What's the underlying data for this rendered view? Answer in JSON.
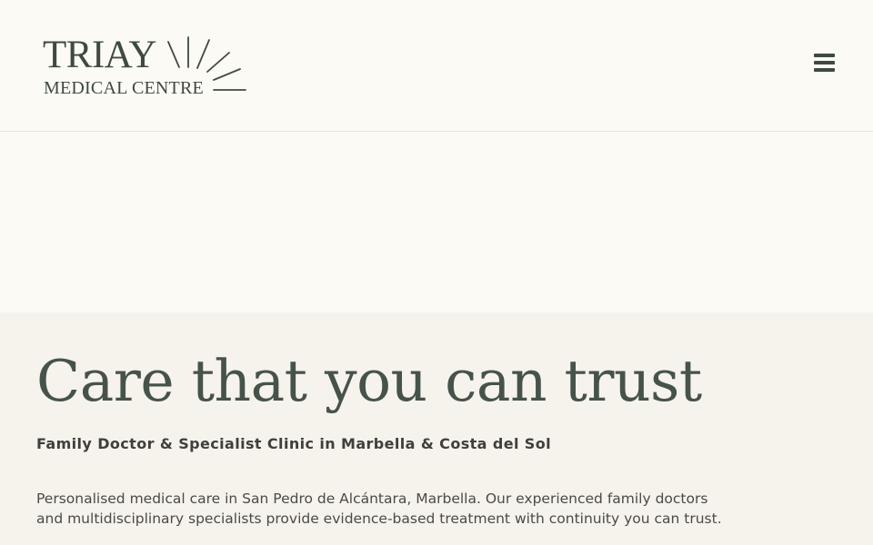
{
  "header": {
    "logo": {
      "title": "TRIAY",
      "subtitle": "MEDICAL CENTRE"
    },
    "menu_button": {
      "icon": "hamburger-menu-icon"
    }
  },
  "hero": {
    "title": "Care that you can trust",
    "subtitle": "Family Doctor & Specialist Clinic in Marbella & Costa del Sol",
    "body_line1": "Personalised medical care in San Pedro de Alcántara, Marbella. Our experienced family doctors",
    "body_line2": "and multidisciplinary specialists provide evidence-based treatment with continuity you can trust."
  },
  "colors": {
    "brand_green": "#3e4a40",
    "header_background": "#fcfaf5",
    "hero_background": "#f6f3ec",
    "body_text": "#4a4a46"
  }
}
